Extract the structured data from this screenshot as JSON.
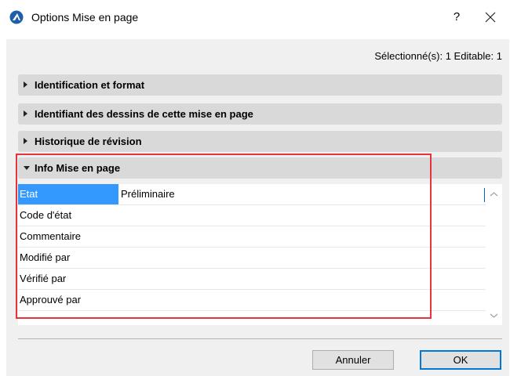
{
  "window": {
    "title": "Options Mise en page",
    "help_label": "?",
    "app_icon": "archicad-icon",
    "close_icon": "close-icon"
  },
  "selection_info": "Sélectionné(s): 1 Editable: 1",
  "sections": [
    {
      "label": "Identification et format",
      "expanded": false
    },
    {
      "label": "Identifiant des dessins de cette mise en page",
      "expanded": false
    },
    {
      "label": "Historique de révision",
      "expanded": false
    },
    {
      "label": "Info Mise en page",
      "expanded": true
    }
  ],
  "info_rows": [
    {
      "key": "Etat",
      "value": "Préliminaire",
      "selected": true
    },
    {
      "key": "Code d'état",
      "value": ""
    },
    {
      "key": "Commentaire",
      "value": ""
    },
    {
      "key": "Modifié par",
      "value": ""
    },
    {
      "key": "Vérifié par",
      "value": ""
    },
    {
      "key": "Approuvé par",
      "value": ""
    }
  ],
  "buttons": {
    "cancel": "Annuler",
    "ok": "OK"
  },
  "colors": {
    "selection": "#3399ff",
    "highlight_border": "#e8333a",
    "default_button_border": "#0078d7"
  }
}
